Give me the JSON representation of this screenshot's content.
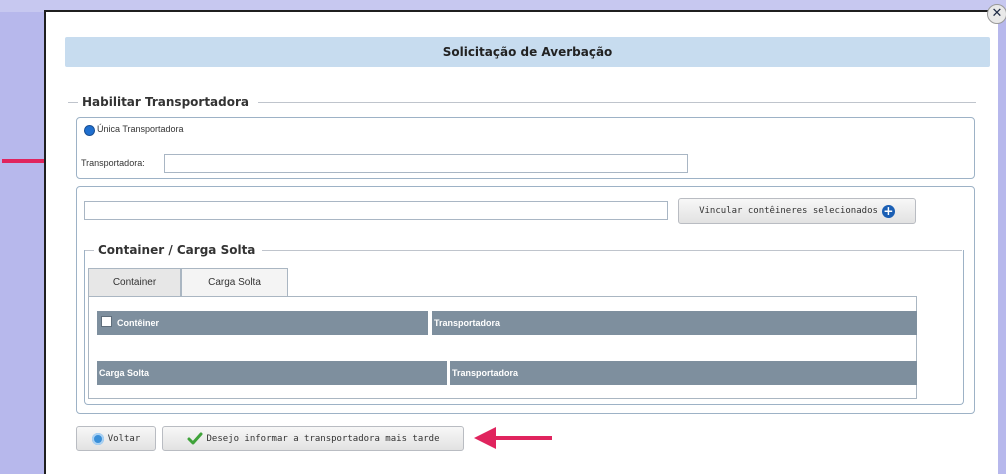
{
  "dialog": {
    "title": "Solicitação de Averbação",
    "close_symbol": "✕"
  },
  "habilitar": {
    "legend": "Habilitar Transportadora",
    "radio_label": "Única Transportadora",
    "field_label": "Transportadora:",
    "field_value": ""
  },
  "vincular": {
    "input_value": "",
    "button_label": "Vincular contêineres selecionados",
    "button_icon": "plus-circle-icon"
  },
  "container_section": {
    "legend": "Container / Carga Solta",
    "tabs": [
      {
        "label": "Container",
        "active": false
      },
      {
        "label": "Carga Solta",
        "active": true
      }
    ],
    "container_table": {
      "col1": "Contêiner",
      "col2": "Transportadora"
    },
    "carga_table": {
      "col1": "Carga Solta",
      "col2": "Transportadora"
    }
  },
  "footer": {
    "back_label": "Voltar",
    "later_label": "Desejo informar a transportadora mais tarde"
  },
  "colors": {
    "arrow": "#e0245e",
    "header": "#7e8f9e",
    "title_bar": "#c7dcef"
  }
}
